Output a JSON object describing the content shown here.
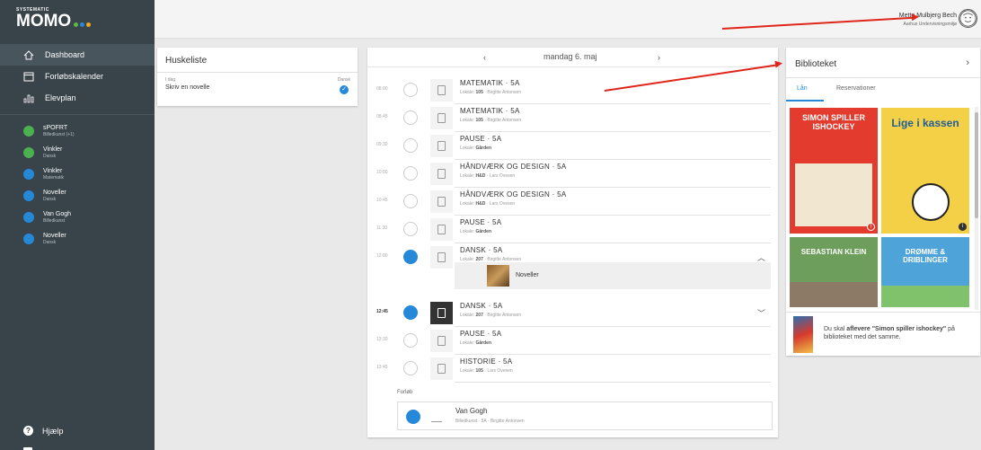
{
  "app": {
    "logo_small": "SYSTEMATIC",
    "logo_main": "MOMO",
    "logo_dots": [
      "#5db946",
      "#2688d8",
      "#f2a81d"
    ]
  },
  "sidebar": {
    "nav": [
      {
        "label": "Dashboard",
        "icon": "home-icon",
        "active": true
      },
      {
        "label": "Forløbskalender",
        "icon": "calendar-icon",
        "active": false
      },
      {
        "label": "Elevplan",
        "icon": "bar-chart-icon",
        "active": false
      }
    ],
    "courses": [
      {
        "name": "sPOFRT",
        "sub": "Billedkunst (+1)",
        "color": "#4caf50"
      },
      {
        "name": "Vinkler",
        "sub": "Dansk",
        "color": "#4caf50"
      },
      {
        "name": "Vinkler",
        "sub": "Matematik",
        "color": "#2688d8"
      },
      {
        "name": "Noveller",
        "sub": "Dansk",
        "color": "#2688d8"
      },
      {
        "name": "Van Gogh",
        "sub": "Billedkunst",
        "color": "#2688d8"
      },
      {
        "name": "Noveller",
        "sub": "Dansk",
        "color": "#2688d8"
      }
    ],
    "help_label": "Hjælp"
  },
  "header": {
    "user_name": "Mette Mulbjerg Bech",
    "user_school": "Aarhus Undervisningsmiljø"
  },
  "huskeliste": {
    "title": "Huskeliste",
    "day_label": "I dag",
    "task": "Skriv en novelle",
    "subject": "Dansk"
  },
  "calendar": {
    "prev": "‹",
    "date": "mandag 6. maj",
    "next": "›",
    "lessons": [
      {
        "time": "08:00",
        "title": "MATEMATIK · 5A",
        "room_label": "Lokale:",
        "room": "105",
        "teacher": "Birgitte Antonsen",
        "done": false
      },
      {
        "time": "08:45",
        "title": "MATEMATIK · 5A",
        "room_label": "Lokale:",
        "room": "105",
        "teacher": "Birgitte Antonsen",
        "done": false
      },
      {
        "time": "09:30",
        "title": "PAUSE · 5A",
        "room_label": "Lokale:",
        "room": "Gården",
        "teacher": "",
        "done": false
      },
      {
        "time": "10:00",
        "title": "HÅNDVÆRK OG DESIGN · 5A",
        "room_label": "Lokale:",
        "room": "H&D",
        "teacher": "Lars Ovesen",
        "done": false
      },
      {
        "time": "10:45",
        "title": "HÅNDVÆRK OG DESIGN · 5A",
        "room_label": "Lokale:",
        "room": "H&D",
        "teacher": "Lars Ovesen",
        "done": false
      },
      {
        "time": "11:30",
        "title": "PAUSE · 5A",
        "room_label": "Lokale:",
        "room": "Gården",
        "teacher": "",
        "done": false
      },
      {
        "time": "12:00",
        "title": "DANSK · 5A",
        "room_label": "Lokale:",
        "room": "207",
        "teacher": "Birgitte Antonsen",
        "done": true
      },
      {
        "time": "12:45",
        "title": "DANSK · 5A",
        "room_label": "Lokale:",
        "room": "207",
        "teacher": "Birgitte Antonsen",
        "done": true
      },
      {
        "time": "13:30",
        "title": "PAUSE · 5A",
        "room_label": "Lokale:",
        "room": "Gården",
        "teacher": "",
        "done": false
      },
      {
        "time": "13:45",
        "title": "HISTORIE · 5A",
        "room_label": "Lokale:",
        "room": "105",
        "teacher": "Lars Ovesen",
        "done": false
      }
    ],
    "expanded_item": "Noveller",
    "forloeb_label": "Forløb",
    "forloeb_title": "Van Gogh",
    "forloeb_meta": "Billedkunst · 5A · Birgitte Antonsen"
  },
  "bibliotek": {
    "title": "Biblioteket",
    "arrow": "›",
    "tabs": [
      "Lån",
      "Reservationer"
    ],
    "books": [
      {
        "title": "SIMON SPILLER ISHOCKEY",
        "bg": "#e33b2d"
      },
      {
        "title": "Lige i kassen",
        "bg": "#f3d046"
      },
      {
        "title": "SEBASTIAN KLEIN",
        "bg": "#6e9e5b"
      },
      {
        "title": "DRØMME & DRIBLINGER",
        "bg": "#4ea4d8"
      }
    ],
    "notice_prefix": "Du skal ",
    "notice_bold": "aflevere \"Simon spiller ishockey\"",
    "notice_suffix": " på biblioteket med det samme."
  }
}
